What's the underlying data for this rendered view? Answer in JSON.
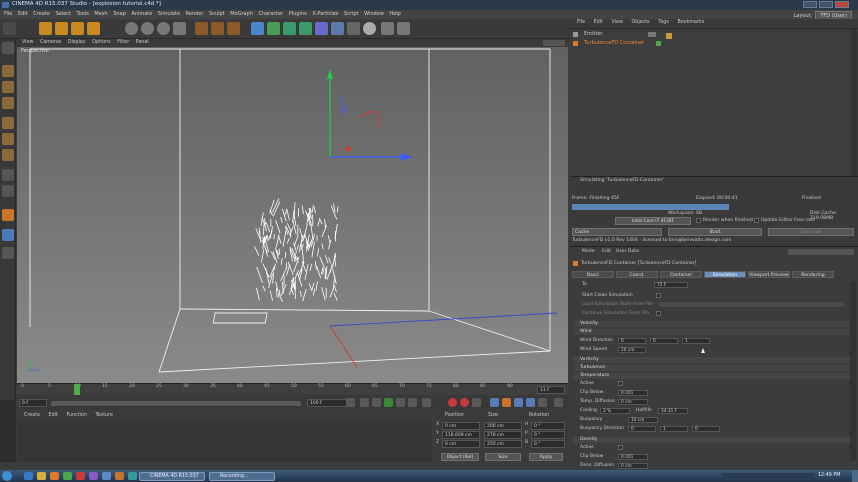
{
  "window": {
    "title": "CINEMA 4D R15.037 Studio - [explosion tutorial.c4d *]"
  },
  "menu": [
    "File",
    "Edit",
    "Create",
    "Select",
    "Tools",
    "Mesh",
    "Snap",
    "Animate",
    "Simulate",
    "Render",
    "Sculpt",
    "MoGraph",
    "Character",
    "Plugins",
    "X-Particles",
    "Script",
    "Window",
    "Help"
  ],
  "layout": {
    "label": "Layout:",
    "value": "TFD (User)"
  },
  "viewport": {
    "menu": [
      "View",
      "Cameras",
      "Display",
      "Options",
      "Filter",
      "Panel"
    ],
    "camera_label": "Perspective"
  },
  "timeline": {
    "ticks": [
      "0",
      "5",
      "10",
      "15",
      "20",
      "25",
      "30",
      "35",
      "40",
      "45",
      "50",
      "55",
      "60",
      "65",
      "70",
      "75",
      "80",
      "85",
      "90"
    ],
    "current_frame": "11 F",
    "end": "0 F"
  },
  "transport": {
    "start_field": "0 F",
    "end_field": "100 F"
  },
  "material_manager": {
    "menu": [
      "Create",
      "Edit",
      "Function",
      "Texture"
    ]
  },
  "coordinates": {
    "headers": [
      "Position",
      "Size",
      "Rotation"
    ],
    "rows": [
      {
        "axis": "X",
        "pos": "0 cm",
        "size": "200 cm",
        "rot_axis": "H",
        "rot": "0 °"
      },
      {
        "axis": "Y",
        "pos": "118.609 cm",
        "size": "278 cm",
        "rot_axis": "P",
        "rot": "0 °"
      },
      {
        "axis": "Z",
        "pos": "0 cm",
        "size": "250 cm",
        "rot_axis": "B",
        "rot": "0 °"
      }
    ],
    "mode": "Object (Rel)",
    "size_mode": "Size",
    "apply": "Apply"
  },
  "object_manager": {
    "menu": [
      "File",
      "Edit",
      "View",
      "Objects",
      "Tags",
      "Bookmarks"
    ],
    "objects": [
      "Emitter",
      "TurbulenceFD Container"
    ]
  },
  "simulation": {
    "header": "Simulating 'TurbulenceFD Container'",
    "frame": "Frame: Finishing 45F",
    "elapsed": "Elapsed: 00:00:41",
    "finished": "Finished",
    "workspace": "Workspace: 6B",
    "disk_cache": "Disk Cache: 219.08MB",
    "device": "Intel Core i7 4C/8T",
    "render_when_finished": "Render when finished",
    "update_editor": "Update Editor Free rate",
    "cache_label": "Cache",
    "start_button": "Start",
    "continue_button": "Continue",
    "license": "TurbulenceFD v1.0 Rev 1404 - licensed to ben@benwatts.design.com"
  },
  "attributes": {
    "menu": [
      "Mode",
      "Edit",
      "User Data"
    ],
    "title": "TurbulenceFD Container [TurbulenceFD Container]",
    "tabs": [
      "Basic",
      "Coord.",
      "Container",
      "Simulation",
      "Viewport Preview",
      "Rendering"
    ],
    "active_tab": "Simulation",
    "to_label": "To",
    "to_value": "75 F",
    "start_clean": "Start Clean Simulation",
    "load_state": "Load Simulation State From File",
    "continue_from": "Continue Simulation From File",
    "sections": {
      "velocity": "Velocity",
      "wind": "Wind",
      "vorticity": "Vorticity",
      "turbulence": "Turbulence",
      "temperature": "Temperature",
      "density": "Density"
    },
    "wind": {
      "direction_label": "Wind Direction",
      "dir_x": "0",
      "dir_y": "0",
      "dir_z": "1",
      "speed_label": "Wind Speed",
      "speed": "20 cm"
    },
    "temperature": {
      "active": "Active",
      "clip_below": "Clip Below",
      "clip_value": "0.001",
      "temp_diffusion": "Temp. Diffusion",
      "temp_diff_value": "0 cm",
      "cooling": "Cooling",
      "cooling_value": "2 %",
      "halflife": "Halflife",
      "halflife_value": "34.31 F",
      "buoyancy": "Buoyancy",
      "buoyancy_value": "10 cm",
      "buoyancy_dir": "Buoyancy Direction",
      "bdir_x": "0",
      "bdir_y": "1",
      "bdir_z": "0"
    },
    "density": {
      "active": "Active",
      "clip_below": "Clip Below",
      "clip_value": "0.001",
      "dens_diffusion": "Dens. Diffusion",
      "dens_value": "0 cm"
    }
  },
  "taskbar": {
    "items": [
      "CINEMA 4D R15.037 ...",
      "Recording..."
    ],
    "time": "12:49 PM"
  },
  "colors": {
    "accent": "#6c8fbc",
    "progress": "#5d84b8",
    "axis_x": "#3a5cff",
    "axis_y": "#22cc44",
    "axis_z": "#dd3333"
  }
}
